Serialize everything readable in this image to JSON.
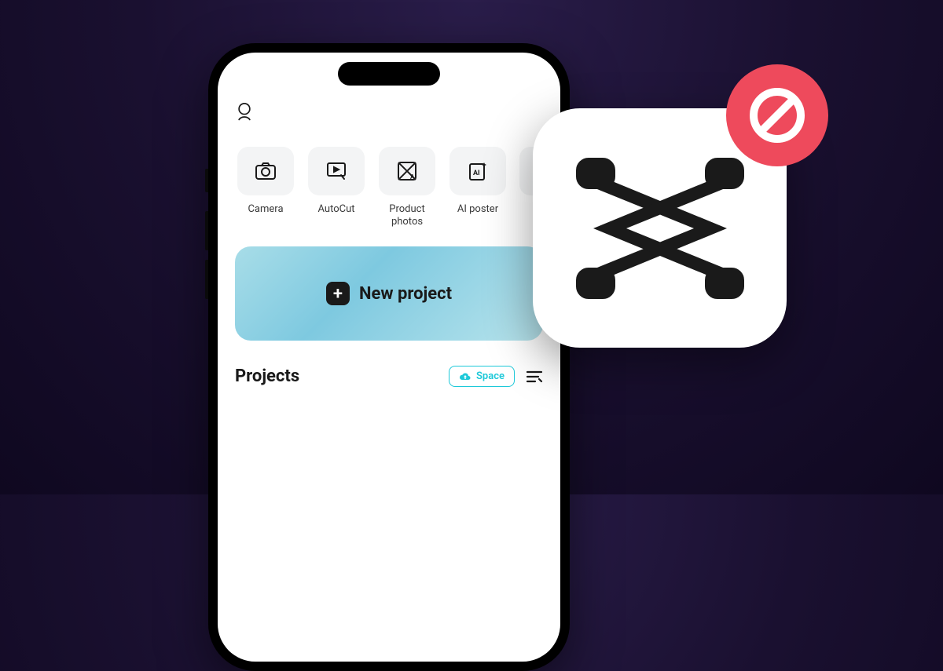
{
  "tools": [
    {
      "label": "Camera",
      "icon": "camera-icon"
    },
    {
      "label": "AutoCut",
      "icon": "autocut-icon"
    },
    {
      "label": "Product photos",
      "icon": "product-photos-icon"
    },
    {
      "label": "AI poster",
      "icon": "ai-poster-icon"
    }
  ],
  "new_project": {
    "label": "New project"
  },
  "projects": {
    "title": "Projects",
    "space_label": "Space"
  }
}
